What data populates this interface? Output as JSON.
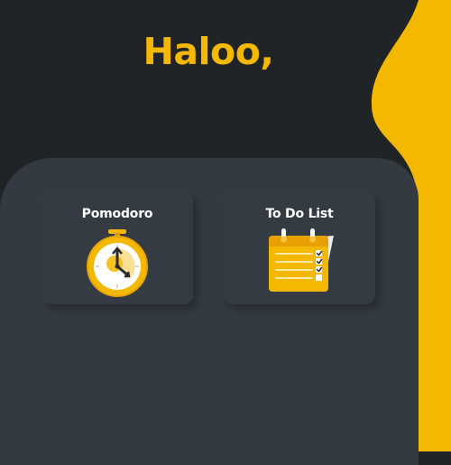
{
  "greeting": "Haloo,",
  "cards": [
    {
      "label": "Pomodoro",
      "icon": "stopwatch-icon"
    },
    {
      "label": "To Do List",
      "icon": "checklist-icon"
    }
  ],
  "colors": {
    "background": "#212427",
    "panel": "#343a42",
    "card": "#353b43",
    "accent": "#f5b800",
    "text": "#ffffff"
  }
}
